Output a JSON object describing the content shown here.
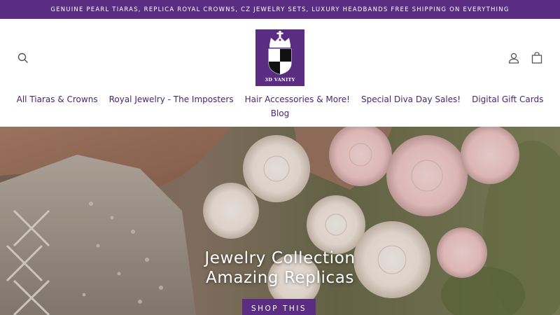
{
  "announcement": "GENUINE PEARL TIARAS, REPLICA ROYAL CROWNS, CZ JEWELRY SETS, LUXURY HEADBANDS FREE SHIPPING ON EVERYTHING",
  "logo": {
    "text": "3D VANITY"
  },
  "icons": {
    "search": "search-icon",
    "account": "account-icon",
    "cart": "cart-icon"
  },
  "nav": {
    "items": [
      {
        "label": "All Tiaras & Crowns"
      },
      {
        "label": "Royal Jewelry - The Imposters"
      },
      {
        "label": "Hair Accessories & More!"
      },
      {
        "label": "Special Diva Day Sales!"
      },
      {
        "label": "Digital Gift Cards"
      }
    ],
    "blog": "Blog"
  },
  "hero": {
    "title_line1": "Jewelry Collection",
    "title_line2": "Amazing Replicas",
    "button": "SHOP THIS"
  },
  "colors": {
    "brand": "#5a2d82",
    "nav_text": "#4a2570"
  }
}
